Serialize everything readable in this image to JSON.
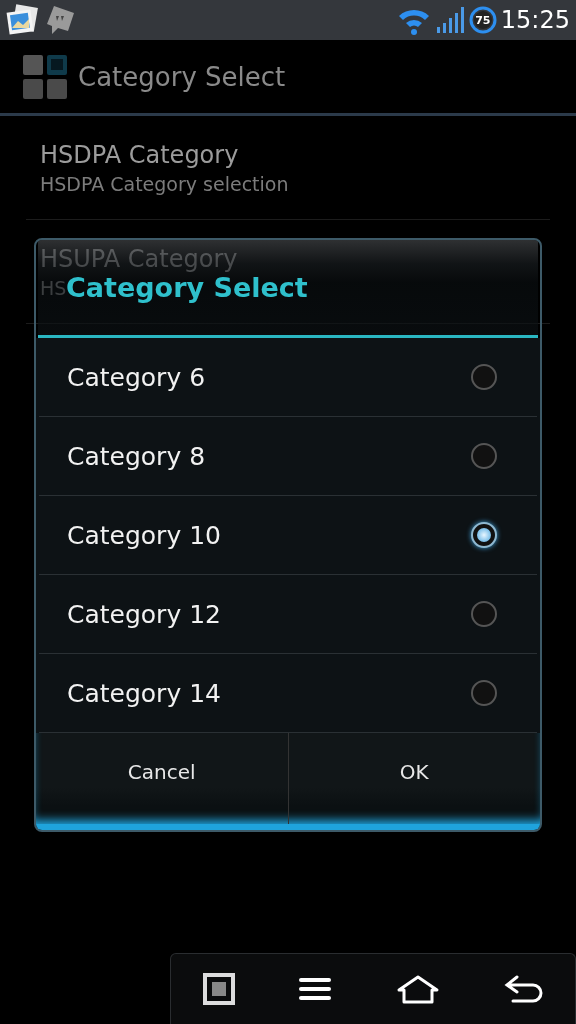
{
  "status_bar": {
    "time": "15:25",
    "battery": "75"
  },
  "app_bar": {
    "title": "Category Select"
  },
  "preferences": [
    {
      "title": "HSDPA Category",
      "summary": "HSDPA Category selection"
    },
    {
      "title": "HSUPA Category",
      "summary": "HS"
    }
  ],
  "dialog": {
    "title": "Category Select",
    "options": [
      {
        "label": "Category 6",
        "selected": false
      },
      {
        "label": "Category 8",
        "selected": false
      },
      {
        "label": "Category 10",
        "selected": true
      },
      {
        "label": "Category 12",
        "selected": false
      },
      {
        "label": "Category 14",
        "selected": false
      }
    ],
    "buttons": [
      "Cancel",
      "OK"
    ]
  }
}
